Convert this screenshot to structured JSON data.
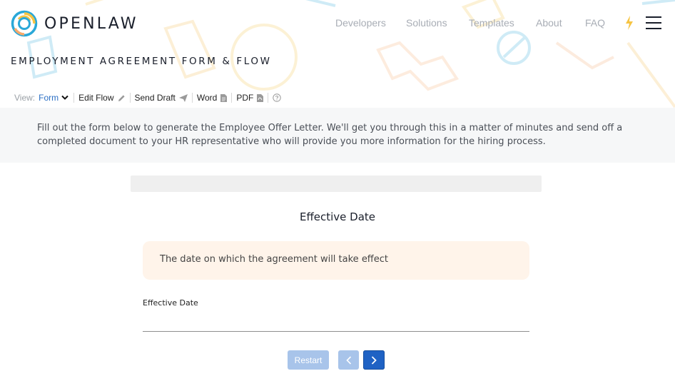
{
  "brand": {
    "name": "OPENLAW"
  },
  "nav": {
    "items": [
      {
        "label": "Developers"
      },
      {
        "label": "Solutions"
      },
      {
        "label": "Templates"
      },
      {
        "label": "About"
      },
      {
        "label": "FAQ"
      }
    ]
  },
  "page": {
    "title": "EMPLOYMENT AGREEMENT FORM & FLOW"
  },
  "toolbar": {
    "view_label": "View:",
    "form_label": "Form",
    "edit_flow_label": "Edit Flow",
    "send_draft_label": "Send Draft",
    "word_label": "Word",
    "pdf_label": "PDF"
  },
  "intro": {
    "text": "Fill out the form below to generate the Employee Offer Letter. We'll get you through this in a matter of minutes and send off a completed document to your HR representative who will provide you more information for the hiring process."
  },
  "form": {
    "section_title": "Effective Date",
    "description": "The date on which the agreement will take effect",
    "field_label": "Effective Date",
    "field_value": "",
    "field_placeholder": ""
  },
  "buttons": {
    "restart_label": "Restart"
  },
  "colors": {
    "accent": "#1f62c4",
    "disabled": "#a8c4ea",
    "brand_blue": "#2aa8d8",
    "brand_yellow": "#f6c443"
  },
  "icons": {
    "logo": "openlaw-ring-logo",
    "bolt": "lightning-bolt-icon",
    "menu": "hamburger-menu-icon",
    "chevron": "chevron-down-icon",
    "pencil": "pencil-icon",
    "send": "paper-plane-icon",
    "word": "document-icon",
    "pdf": "pdf-icon",
    "help": "help-circle-icon",
    "prev": "chevron-left-icon",
    "next": "chevron-right-icon"
  }
}
